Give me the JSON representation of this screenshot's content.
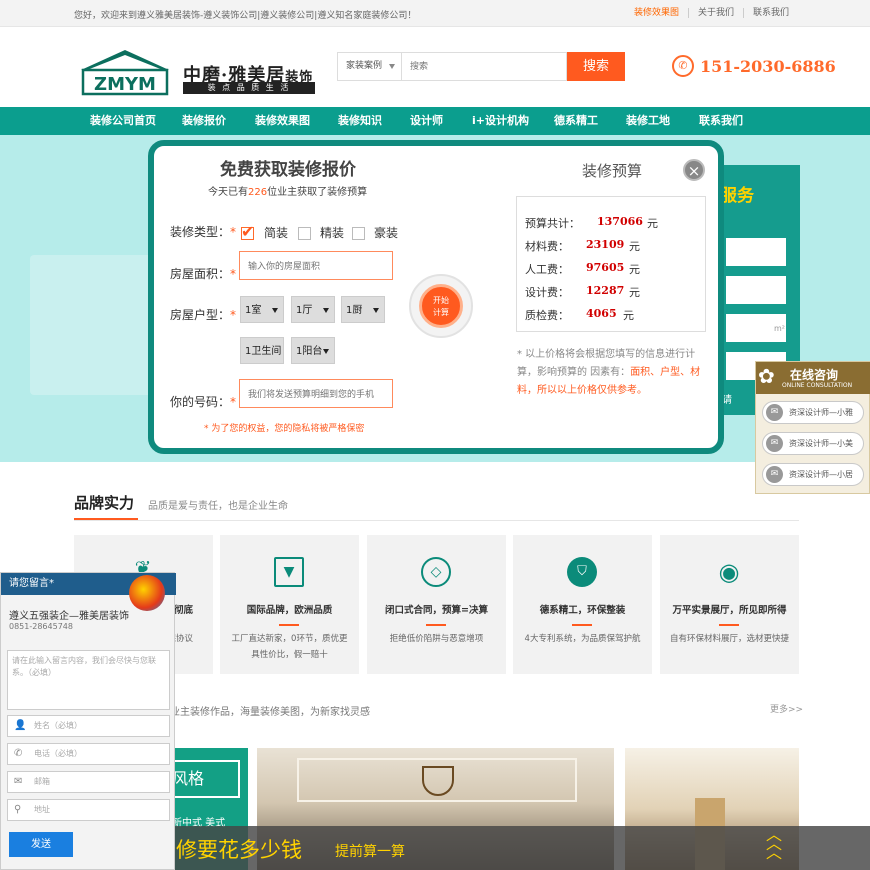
{
  "topbar": {
    "welcome": "您好，欢迎来到遵义雅美居装饰-遵义装饰公司|遵义装修公司|遵义知名家庭装修公司！",
    "links": [
      "装修效果图",
      "关于我们",
      "联系我们"
    ]
  },
  "header": {
    "logo_letters": "ZMYM",
    "logo_name": "中磨·雅美居",
    "logo_suffix": "装饰",
    "logo_slogan": "装 点 品 质 生 活",
    "search_category": "家装案例",
    "search_placeholder": "搜索",
    "search_button": "搜索",
    "phone": "151-2030-6886"
  },
  "nav": [
    "装修公司首页",
    "装修报价",
    "装修效果图",
    "装修知识",
    "设计师",
    "i+设计机构",
    "德系精工",
    "装修工地",
    "联系我们"
  ],
  "hero": {
    "side_title": "服务",
    "side_unit": "m²",
    "side_button": "请"
  },
  "modal": {
    "title": "免费获取装修报价",
    "subtitle_pre": "今天已有",
    "subtitle_count": "226",
    "subtitle_post": "位业主获取了装修预算",
    "type_label": "装修类型：",
    "types": [
      "简装",
      "精装",
      "豪装"
    ],
    "area_label": "房屋面积：",
    "area_placeholder": "输入你的房屋面积",
    "layout_label": "房屋户型：",
    "layout_selects": [
      "1室",
      "1厅",
      "1厨",
      "1卫生间",
      "1阳台"
    ],
    "phone_label": "你的号码：",
    "phone_placeholder": "我们将发送预算明细到您的手机",
    "privacy": "* 为了您的权益，您的隐私将被严格保密",
    "calc_button_line1": "开始",
    "calc_button_line2": "计算",
    "budget_title": "装修预算",
    "close_icon": "×",
    "budget": [
      {
        "label": "预算共计：",
        "value": "137066",
        "unit": "元"
      },
      {
        "label": "材料费：",
        "value": "23109",
        "unit": "元"
      },
      {
        "label": "人工费：",
        "value": "97605",
        "unit": "元"
      },
      {
        "label": "设计费：",
        "value": "12287",
        "unit": "元"
      },
      {
        "label": "质检费：",
        "value": "4065",
        "unit": "元"
      }
    ],
    "note_pre": "* 以上价格将会根据您填写的信息进行计算，影响预算的 因素有：",
    "note_hl": "面积、户型、材料，所以以上价格仅供参考。"
  },
  "brand": {
    "title": "品牌实力",
    "subtitle": "品质是爱与责任，也是企业生命",
    "cards": [
      {
        "title": "彻底",
        "desc": "保协议"
      },
      {
        "title": "国际品牌，欧洲品质",
        "desc": "工厂直达新家，0环节，质优更具性价比，假一赔十"
      },
      {
        "title": "闭口式合同，预算=决算",
        "desc": "拒绝低价陷阱与恶意增项"
      },
      {
        "title": "德系精工，环保整装",
        "desc": "4大专利系统，为品质保驾护航"
      },
      {
        "title": "万平实景展厅，所见即所得",
        "desc": "自有环保材料展厅，选材更快捷"
      }
    ]
  },
  "cases": {
    "subtitle": "业主装修作品，海量装修美图，为新家找灵感",
    "more": "更多>>",
    "tag": "风格",
    "styles": "新中式  美式"
  },
  "bottom_band": {
    "big": "修要花多少钱",
    "small": "提前算一算"
  },
  "message_widget": {
    "header": "请您留言*",
    "company": "遵义五强装企—雅美居装饰",
    "tel": "0851-28645748",
    "textarea_placeholder": "请在此输入留言内容，我们会尽快与您联系。（必填）",
    "name_placeholder": "姓名（必填）",
    "phone_placeholder": "电话（必填）",
    "email_placeholder": "邮箱",
    "address_placeholder": "地址",
    "send": "发送"
  },
  "consult_widget": {
    "title": "在线咨询",
    "subtitle": "ONLINE CONSULTATION",
    "items": [
      "资深设计师—小雅",
      "资深设计师—小美",
      "资深设计师—小居"
    ]
  },
  "colors": {
    "accent": "#ff5a1f",
    "teal": "#0b9e8e",
    "hero_bg": "#b6ecea"
  }
}
